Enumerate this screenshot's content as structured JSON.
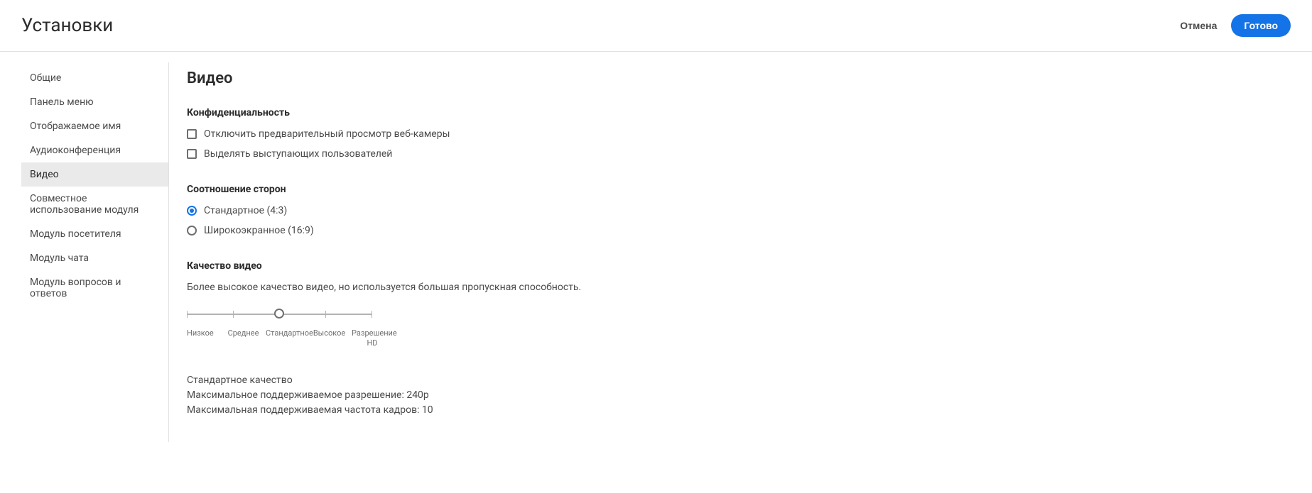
{
  "header": {
    "title": "Установки",
    "cancel_label": "Отмена",
    "done_label": "Готово"
  },
  "sidebar": {
    "items": [
      {
        "label": "Общие",
        "active": false
      },
      {
        "label": "Панель меню",
        "active": false
      },
      {
        "label": "Отображаемое имя",
        "active": false
      },
      {
        "label": "Аудиоконференция",
        "active": false
      },
      {
        "label": "Видео",
        "active": true
      },
      {
        "label": "Совместное использование модуля",
        "active": false
      },
      {
        "label": "Модуль посетителя",
        "active": false
      },
      {
        "label": "Модуль чата",
        "active": false
      },
      {
        "label": "Модуль вопросов и ответов",
        "active": false
      }
    ]
  },
  "content": {
    "title": "Видео",
    "privacy": {
      "heading": "Конфиденциальность",
      "options": [
        {
          "label": "Отключить предварительный просмотр веб-камеры",
          "checked": false
        },
        {
          "label": "Выделять выступающих пользователей",
          "checked": false
        }
      ]
    },
    "aspect": {
      "heading": "Соотношение сторон",
      "options": [
        {
          "label": "Стандартное (4:3)",
          "selected": true
        },
        {
          "label": "Широкоэкранное (16:9)",
          "selected": false
        }
      ]
    },
    "quality": {
      "heading": "Качество видео",
      "description": "Более высокое качество видео, но используется большая пропускная способность.",
      "slider": {
        "ticks": [
          "Низкое",
          "Среднее",
          "Стандартное",
          "Высокое",
          "Разрешение HD"
        ],
        "selected_index": 2
      },
      "info": {
        "line1": "Стандартное качество",
        "line2": "Максимальное поддерживаемое разрешение: 240p",
        "line3": "Максимальная поддерживаемая частота кадров: 10"
      }
    }
  }
}
